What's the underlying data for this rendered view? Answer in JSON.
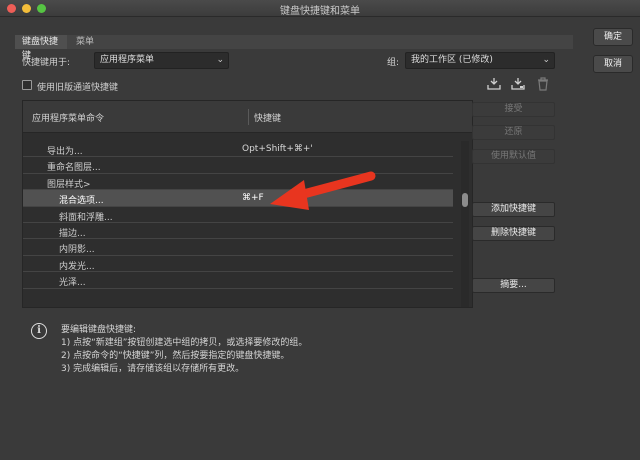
{
  "window": {
    "title": "键盘快捷键和菜单"
  },
  "tabs": [
    {
      "label": "键盘快捷键"
    },
    {
      "label": "菜单"
    }
  ],
  "form": {
    "shortcuts_for_label": "快捷键用于:",
    "shortcuts_for_value": "应用程序菜单",
    "group_label": "组:",
    "group_value": "我的工作区 (已修改)",
    "legacy_checkbox_label": "使用旧版通道快捷键"
  },
  "table": {
    "header_command": "应用程序菜单命令",
    "header_shortcut": "快捷键",
    "rows": [
      {
        "command": "导出为...",
        "shortcut": "Opt+Shift+⌘+'"
      },
      {
        "command": "重命名图层...",
        "shortcut": ""
      },
      {
        "command": "图层样式>",
        "shortcut": ""
      },
      {
        "command": "混合选项...",
        "shortcut": "⌘+F"
      },
      {
        "command": "斜面和浮雕...",
        "shortcut": ""
      },
      {
        "command": "描边...",
        "shortcut": ""
      },
      {
        "command": "内阴影...",
        "shortcut": ""
      },
      {
        "command": "内发光...",
        "shortcut": ""
      },
      {
        "command": "光泽...",
        "shortcut": ""
      }
    ]
  },
  "side_buttons": {
    "accept": "接受",
    "undo": "还原",
    "use_default": "使用默认值",
    "add_shortcut": "添加快捷键",
    "delete_shortcut": "删除快捷键",
    "summary": "摘要..."
  },
  "info": {
    "heading": "要编辑键盘快捷键:",
    "step1": "1) 点按“新建组”按钮创建选中组的拷贝，或选择要修改的组。",
    "step2": "2) 点按命令的“快捷键”列，然后按要指定的键盘快捷键。",
    "step3": "3) 完成编辑后，请存储该组以存储所有更改。"
  },
  "dialog_buttons": {
    "ok": "确定",
    "cancel": "取消"
  },
  "icons": {
    "save_group": "save-set-icon",
    "save_group_as": "save-set-as-icon",
    "delete_group": "trash-icon",
    "info": "info-icon",
    "annotation": "red-arrow-icon"
  },
  "colors": {
    "arrow": "#e8351f",
    "selected_row": "#515151",
    "background": "#3a3a3a"
  }
}
